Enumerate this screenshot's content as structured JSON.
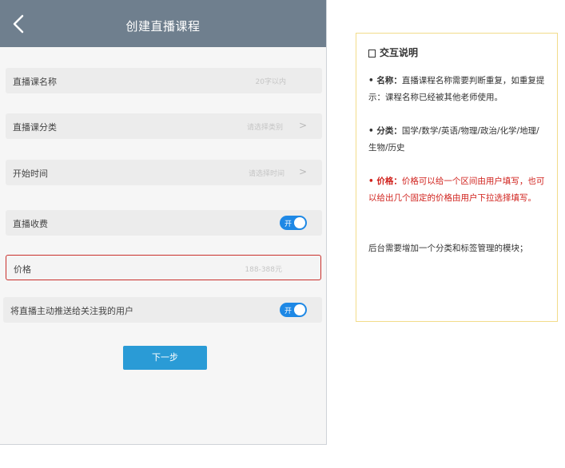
{
  "header": {
    "title": "创建直播课程"
  },
  "form": {
    "name": {
      "label": "直播课名称",
      "hint": "20字以内"
    },
    "category": {
      "label": "直播课分类",
      "hint": "请选择类别",
      "chevron": ">"
    },
    "start_time": {
      "label": "开始时间",
      "hint": "请选择时间",
      "chevron": ">"
    },
    "charge": {
      "label": "直播收费",
      "toggle_text": "开"
    },
    "price": {
      "label": "价格",
      "hint": "188-388元"
    },
    "push": {
      "label": "将直播主动推送给关注我的用户",
      "toggle_text": "开"
    },
    "next_label": "下一步"
  },
  "note": {
    "title": "交互说明",
    "name_head": "• 名称：",
    "name_body": "直播课程名称需要判断重复，如重复提示：课程名称已经被其他老师使用。",
    "category_head": "• 分类：",
    "category_body": "国学/数学/英语/物理/政治/化学/地理/生物/历史",
    "price_head": "• 价格：",
    "price_body": "价格可以给一个区间由用户填写，也可以给出几个固定的价格由用户下拉选择填写。",
    "footer": "后台需要增加一个分类和标签管理的模块；"
  },
  "colors": {
    "header": "#6f7f8e",
    "accent": "#1e88e5",
    "button": "#2a9bd6",
    "error": "#c9302c",
    "note_border": "#f2dc8a",
    "note_red": "#d0211c"
  }
}
